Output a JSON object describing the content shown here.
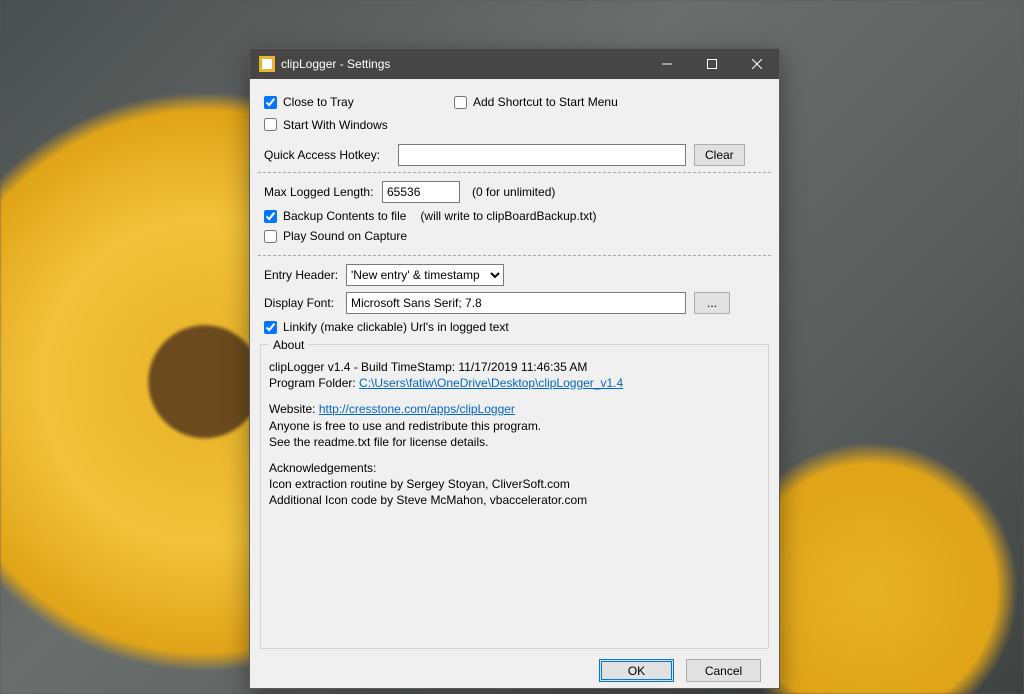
{
  "window": {
    "title": "clipLogger - Settings"
  },
  "opts": {
    "close_to_tray": {
      "label": "Close to Tray",
      "checked": true
    },
    "add_shortcut": {
      "label": "Add Shortcut to Start Menu",
      "checked": false
    },
    "start_windows": {
      "label": "Start With Windows",
      "checked": false
    },
    "hotkey_label": "Quick Access Hotkey:",
    "hotkey_value": "",
    "clear_btn": "Clear"
  },
  "logging": {
    "maxlen_label": "Max Logged Length:",
    "maxlen_value": "65536",
    "maxlen_hint": "(0 for unlimited)",
    "backup": {
      "label": "Backup Contents to file",
      "checked": true
    },
    "backup_hint": "(will write to clipBoardBackup.txt)",
    "playsound": {
      "label": "Play Sound on Capture",
      "checked": false
    }
  },
  "display": {
    "entryheader_label": "Entry Header:",
    "entryheader_value": "'New entry' & timestamp",
    "font_label": "Display Font:",
    "font_value": "Microsoft Sans Serif; 7.8",
    "font_btn": "...",
    "linkify": {
      "label": "Linkify (make clickable) Url's in logged text",
      "checked": true
    }
  },
  "about": {
    "caption": "About",
    "line1a": "clipLogger v1.4   -   Build TimeStamp: 11/17/2019 11:46:35 AM",
    "folder_label": "Program Folder: ",
    "folder_link": "C:\\Users\\fatiw\\OneDrive\\Desktop\\clipLogger_v1.4",
    "website_label": "Website: ",
    "website_link": "http://cresstone.com/apps/clipLogger",
    "line3": "Anyone is free to use and redistribute this program.",
    "line4": "See the readme.txt file for license details.",
    "ack_title": "Acknowledgements:",
    "ack1": "Icon extraction routine by Sergey Stoyan, CliverSoft.com",
    "ack2": "Additional Icon code by Steve McMahon, vbaccelerator.com"
  },
  "buttons": {
    "ok": "OK",
    "cancel": "Cancel"
  }
}
